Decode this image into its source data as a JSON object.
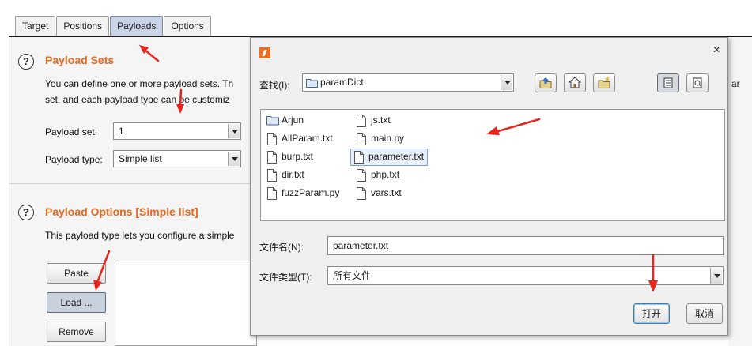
{
  "tabs": [
    "Target",
    "Positions",
    "Payloads",
    "Options"
  ],
  "active_tab": "Payloads",
  "payload_sets": {
    "title": "Payload Sets",
    "desc_line1": "You can define one or more payload sets. Th",
    "desc_line2": "set, and each payload type can be customiz",
    "set_label": "Payload set:",
    "set_value": "1",
    "type_label": "Payload type:",
    "type_value": "Simple list"
  },
  "payload_options": {
    "title": "Payload Options [Simple list]",
    "desc": "This payload type lets you configure a simple",
    "paste_label": "Paste",
    "load_label": "Load ...",
    "remove_label": "Remove"
  },
  "right_edge_text": "ar",
  "dialog": {
    "close_glyph": "×",
    "lookin_label": "查找(I):",
    "lookin_value": "paramDict",
    "files_col1": [
      {
        "name": "Arjun",
        "kind": "folder"
      },
      {
        "name": "AllParam.txt",
        "kind": "file"
      },
      {
        "name": "burp.txt",
        "kind": "file"
      },
      {
        "name": "dir.txt",
        "kind": "file"
      },
      {
        "name": "fuzzParam.py",
        "kind": "file"
      }
    ],
    "files_col2": [
      {
        "name": "js.txt",
        "kind": "file"
      },
      {
        "name": "main.py",
        "kind": "file"
      },
      {
        "name": "parameter.txt",
        "kind": "file",
        "selected": true
      },
      {
        "name": "php.txt",
        "kind": "file"
      },
      {
        "name": "vars.txt",
        "kind": "file"
      }
    ],
    "filename_label": "文件名(N):",
    "filename_value": "parameter.txt",
    "filetype_label": "文件类型(T):",
    "filetype_value": "所有文件",
    "open_label": "打开",
    "cancel_label": "取消",
    "toolbar_icons": [
      "up-folder-icon",
      "home-icon",
      "new-folder-icon",
      "list-view-icon",
      "details-view-icon"
    ]
  },
  "colors": {
    "section_title": "#e8691e",
    "annotation_arrow": "#e8261e",
    "active_tab": "#c9d4e6"
  }
}
